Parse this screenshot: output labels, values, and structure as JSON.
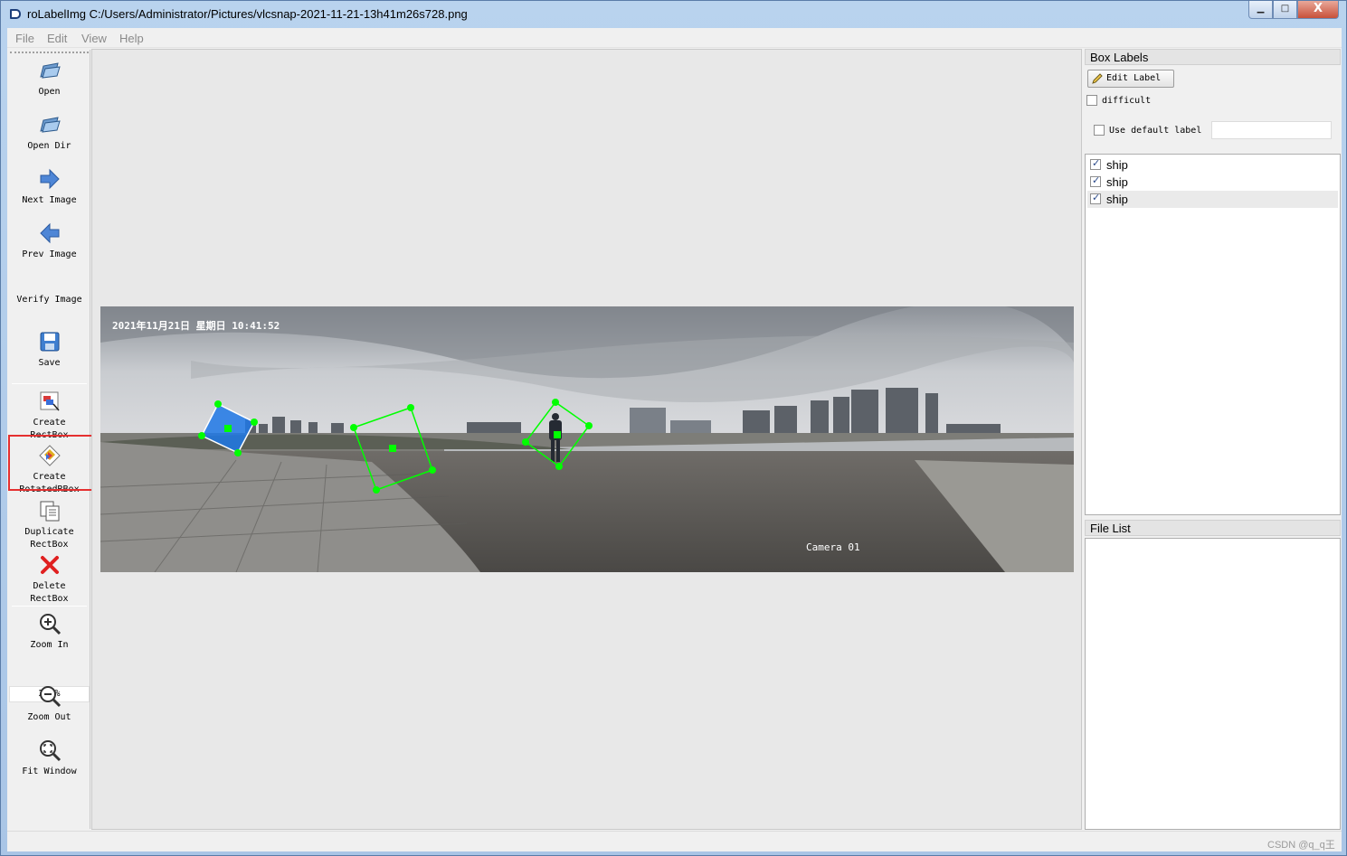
{
  "window": {
    "title": "roLabelImg C:/Users/Administrator/Pictures/vlcsnap-2021-11-21-13h41m26s728.png",
    "min_glyph": "▁",
    "max_glyph": "□",
    "close_glyph": "X"
  },
  "menu": [
    "File",
    "Edit",
    "View",
    "Help"
  ],
  "toolbar": {
    "open": "Open",
    "open_dir": "Open Dir",
    "next_image": "Next Image",
    "prev_image": "Prev Image",
    "verify_image": "Verify Image",
    "save": "Save",
    "create_rectbox_1": "Create",
    "create_rectbox_2": "RectBox",
    "create_rotated_1": "Create",
    "create_rotated_2": "RotatedRBox",
    "duplicate_1": "Duplicate",
    "duplicate_2": "RectBox",
    "delete_1": "Delete",
    "delete_2": "RectBox",
    "zoom_in": "Zoom In",
    "zoom_value": "21 %",
    "zoom_out": "Zoom Out",
    "fit_window": "Fit Window",
    "more": "»"
  },
  "image_overlay": {
    "timestamp": "2021年11月21日 星期日 10:41:52",
    "camera": "Camera 01"
  },
  "box_labels": {
    "title": "Box Labels",
    "edit_label": "Edit Label",
    "difficult": "difficult",
    "difficult_checked": false,
    "use_default_label": "Use default label",
    "use_default_checked": false,
    "default_label_value": "",
    "labels": [
      {
        "text": "ship",
        "checked": true,
        "selected": false
      },
      {
        "text": "ship",
        "checked": true,
        "selected": false
      },
      {
        "text": "ship",
        "checked": true,
        "selected": true
      }
    ]
  },
  "file_list": {
    "title": "File List",
    "items": []
  },
  "watermark": "CSDN @q_q王",
  "colors": {
    "highlight": "#e53030",
    "shape_green": "#00ff00",
    "selected_fill": "#1e78e6"
  }
}
